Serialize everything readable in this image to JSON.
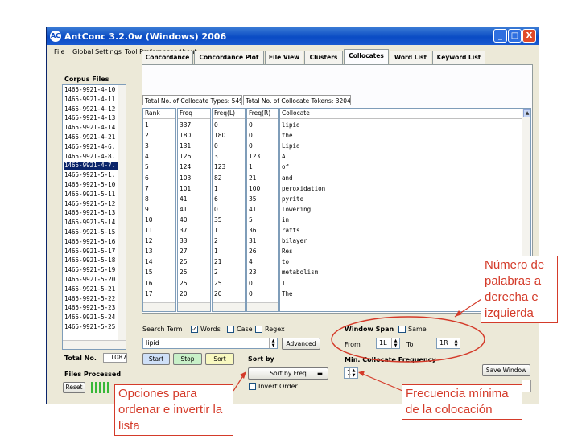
{
  "window": {
    "app_icon": "AC",
    "title": "AntConc 3.2.0w (Windows) 2006",
    "controls": {
      "minimize": "_",
      "maximize": "□",
      "close": "X"
    }
  },
  "menu": [
    "File",
    "Global Settings",
    "Tool Preferences",
    "About"
  ],
  "corpus": {
    "label": "Corpus Files",
    "files": [
      "1465-9921-4-10",
      "1465-9921-4-11",
      "1465-9921-4-12",
      "1465-9921-4-13",
      "1465-9921-4-14",
      "1465-9921-4-21",
      "1465-9921-4-6.",
      "1465-9921-4-8.",
      "1465-9921-4-7.",
      "1465-9921-5-1.",
      "1465-9921-5-10",
      "1465-9921-5-11",
      "1465-9921-5-12",
      "1465-9921-5-13",
      "1465-9921-5-14",
      "1465-9921-5-15",
      "1465-9921-5-16",
      "1465-9921-5-17",
      "1465-9921-5-18",
      "1465-9921-5-19",
      "1465-9921-5-20",
      "1465-9921-5-21",
      "1465-9921-5-22",
      "1465-9921-5-23",
      "1465-9921-5-24",
      "1465-9921-5-25"
    ],
    "selected_index": 8,
    "total_label": "Total No.",
    "total_value": "1087",
    "files_processed_label": "Files Processed",
    "reset_label": "Reset"
  },
  "tabs": [
    "Concordance",
    "Concordance Plot",
    "File View",
    "Clusters",
    "Collocates",
    "Word List",
    "Keyword List"
  ],
  "active_tab": 4,
  "info": {
    "collocate_types": "Total No. of Collocate Types: 549",
    "collocate_tokens": "Total No. of Collocate Tokens: 3204"
  },
  "table": {
    "headers": [
      "Rank",
      "Freq",
      "Freq(L)",
      "Freq(R)",
      "Collocate"
    ],
    "rows": [
      [
        "1",
        "337",
        "0",
        "0",
        "lipid"
      ],
      [
        "2",
        "180",
        "180",
        "0",
        "the"
      ],
      [
        "3",
        "131",
        "0",
        "0",
        "Lipid"
      ],
      [
        "4",
        "126",
        "3",
        "123",
        "A"
      ],
      [
        "5",
        "124",
        "123",
        "1",
        "of"
      ],
      [
        "6",
        "103",
        "82",
        "21",
        "and"
      ],
      [
        "7",
        "101",
        "1",
        "100",
        "peroxidation"
      ],
      [
        "8",
        "41",
        "6",
        "35",
        "pyrite"
      ],
      [
        "9",
        "41",
        "0",
        "41",
        "lowering"
      ],
      [
        "10",
        "40",
        "35",
        "5",
        "in"
      ],
      [
        "11",
        "37",
        "1",
        "36",
        "rafts"
      ],
      [
        "12",
        "33",
        "2",
        "31",
        "bilayer"
      ],
      [
        "13",
        "27",
        "1",
        "26",
        "Res"
      ],
      [
        "14",
        "25",
        "21",
        "4",
        "to"
      ],
      [
        "15",
        "25",
        "2",
        "23",
        "metabolism"
      ],
      [
        "16",
        "25",
        "25",
        "0",
        "T"
      ],
      [
        "17",
        "20",
        "20",
        "0",
        "The"
      ]
    ]
  },
  "search": {
    "term_label": "Search Term",
    "words_label": "Words",
    "case_label": "Case",
    "regex_label": "Regex",
    "words_checked": true,
    "case_checked": false,
    "regex_checked": false,
    "query": "lipid",
    "advanced_label": "Advanced",
    "start_label": "Start",
    "stop_label": "Stop",
    "sort_btn_label": "Sort"
  },
  "sort": {
    "label": "Sort by",
    "value": "Sort by Freq",
    "invert_label": "Invert Order"
  },
  "window_span": {
    "label": "Window Span",
    "same_label": "Same",
    "from_label": "From",
    "from_value": "1L",
    "to_label": "To",
    "to_value": "1R"
  },
  "min_freq": {
    "label": "Min. Collocate Frequency",
    "value": "1"
  },
  "save_window_label": "Save Window",
  "annotations": {
    "span": "Número de palabras a derecha e izquierda",
    "sort": "Opciones para ordenar e invertir la lista",
    "freq": "Frecuencia mínima de la colocación"
  },
  "colors": {
    "accent_blue": "#0a4bc4",
    "annotation_red": "#d43b2a",
    "progress_green": "#38b838",
    "start_btn": "#cfe0f8",
    "stop_btn": "#c8f0c8",
    "sort_btn": "#f8f8c0"
  }
}
